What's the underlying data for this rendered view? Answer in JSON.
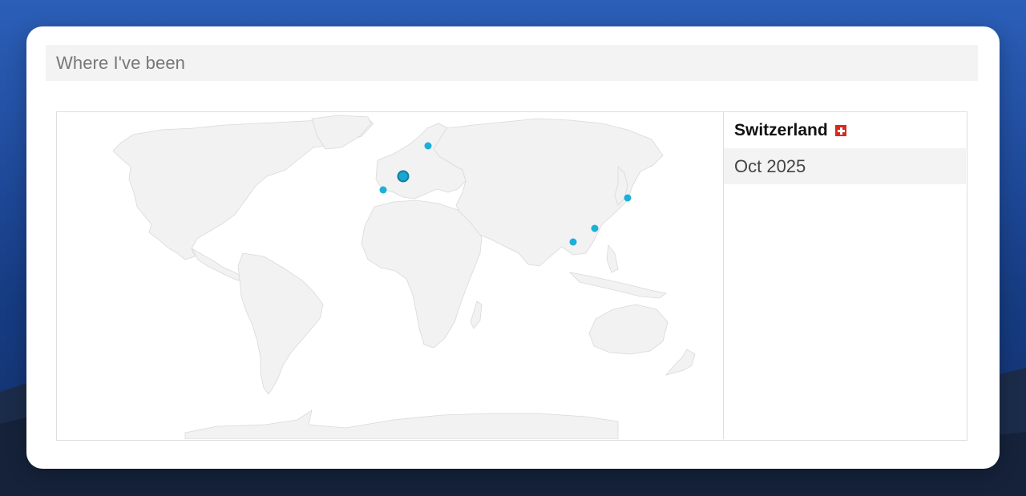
{
  "header": {
    "title": "Where I've been"
  },
  "map": {
    "markers": [
      {
        "id": "switzerland",
        "active": true
      },
      {
        "id": "spain",
        "active": false
      },
      {
        "id": "finland",
        "active": false
      },
      {
        "id": "japan",
        "active": false
      },
      {
        "id": "hong-kong",
        "active": false
      },
      {
        "id": "thailand",
        "active": false
      }
    ]
  },
  "detail": {
    "country": "Switzerland",
    "flag_icon": "swiss-flag-icon",
    "date": "Oct 2025"
  },
  "colors": {
    "marker": "#1ab0d8",
    "land": "#f2f2f2",
    "border": "#dedede"
  }
}
